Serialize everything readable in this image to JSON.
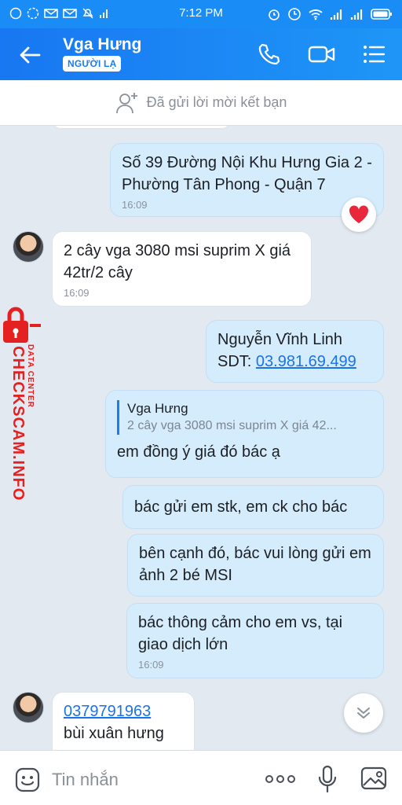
{
  "status": {
    "time": "7:12 PM"
  },
  "header": {
    "contact_name": "Vga Hưng",
    "badge": "NGƯỜI LẠ"
  },
  "friend_bar": {
    "text": "Đã gửi lời mời kết bạn"
  },
  "messages": [
    {
      "dir": "out",
      "text": "Số 39 Đường Nội Khu Hưng Gia 2 - Phường Tân Phong - Quận 7",
      "time": "16:09"
    },
    {
      "dir": "in",
      "text": "2 cây vga 3080 msi suprim X giá 42tr/2 cây",
      "time": "16:09"
    },
    {
      "dir": "out",
      "line1": "Nguyễn Vĩnh Linh",
      "sdt_label": "SDT: ",
      "phone": "03.981.69.499"
    },
    {
      "dir": "out",
      "quote_name": "Vga Hưng",
      "quote_text": "2 cây vga 3080 msi suprim X  giá 42...",
      "text": "em đồng ý giá đó bác ạ"
    },
    {
      "dir": "out",
      "text": "bác gửi em stk, em ck cho bác"
    },
    {
      "dir": "out",
      "text": "bên cạnh đó, bác vui lòng gửi em ảnh 2 bé MSI"
    },
    {
      "dir": "out",
      "text": "bác thông cảm cho em vs, tại giao dịch lớn",
      "time": "16:09"
    },
    {
      "dir": "in",
      "phone": "0379791963",
      "text": "bùi xuân hưng"
    }
  ],
  "watermark": {
    "brand": "CHECKSCAM.INFO",
    "sub": "DATA CENTER"
  },
  "input": {
    "placeholder": "Tin nhắn"
  },
  "colors": {
    "header": "#1a8cf5",
    "out_bubble": "#d5ecfc",
    "in_bubble": "#ffffff",
    "link": "#1a73e8",
    "watermark": "#e52020"
  }
}
